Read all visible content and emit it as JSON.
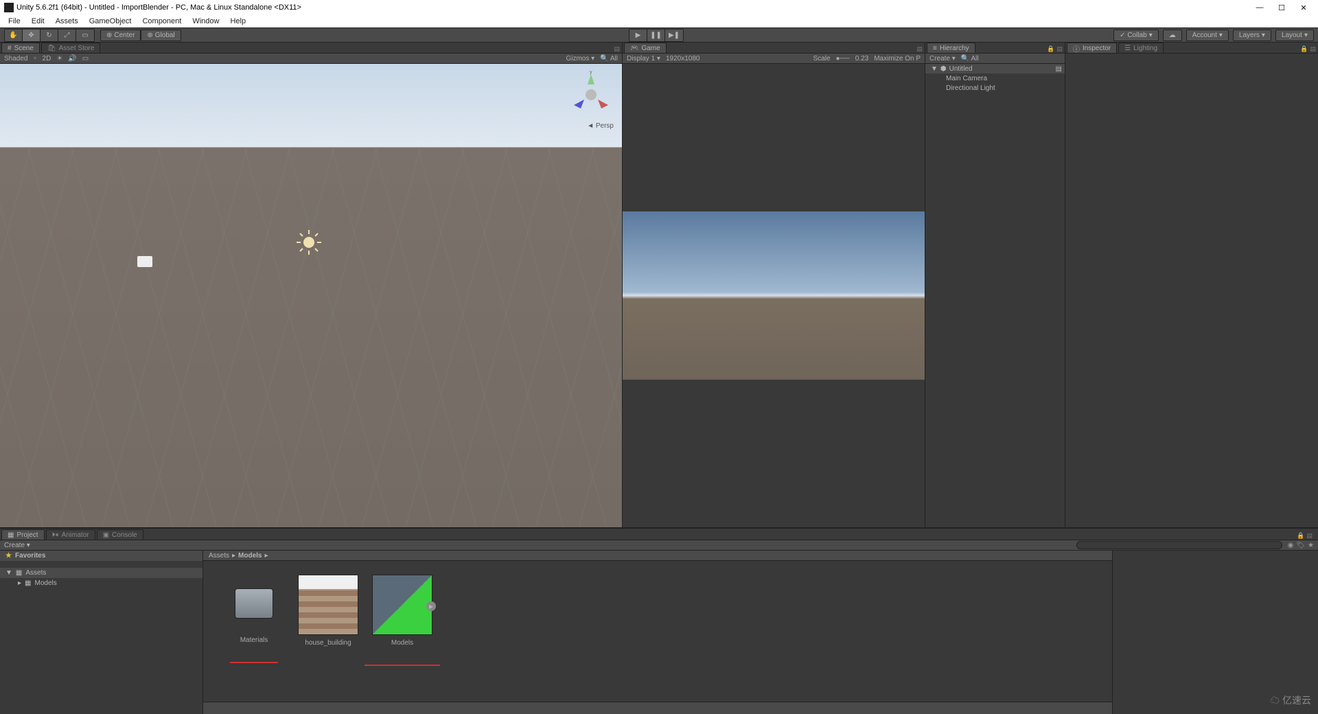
{
  "titlebar": {
    "title": "Unity 5.6.2f1 (64bit) - Untitled - ImportBlender - PC, Mac & Linux Standalone <DX11>"
  },
  "menubar": [
    "File",
    "Edit",
    "Assets",
    "GameObject",
    "Component",
    "Window",
    "Help"
  ],
  "toolbar": {
    "center": "Center",
    "global": "Global",
    "collab": "Collab",
    "account": "Account",
    "layers": "Layers",
    "layout": "Layout"
  },
  "scene": {
    "tab": "Scene",
    "tab2": "Asset Store",
    "shaded": "Shaded",
    "mode2d": "2D",
    "gizmos": "Gizmos",
    "search_placeholder": "All",
    "persp": "Persp"
  },
  "game": {
    "tab": "Game",
    "display": "Display 1",
    "resolution": "1920x1080",
    "scale": "Scale",
    "scale_val": "0.23",
    "maximize": "Maximize On P"
  },
  "hierarchy": {
    "tab": "Hierarchy",
    "create": "Create",
    "search_placeholder": "All",
    "scene_name": "Untitled",
    "items": [
      "Main Camera",
      "Directional Light"
    ]
  },
  "inspector": {
    "tab": "Inspector",
    "tab2": "Lighting"
  },
  "project": {
    "tab": "Project",
    "tab2": "Animator",
    "tab3": "Console",
    "create": "Create",
    "favorites": "Favorites",
    "assets": "Assets",
    "models": "Models",
    "breadcrumb": [
      "Assets",
      "Models"
    ],
    "items": [
      {
        "name": "Materials",
        "type": "folder",
        "underline": true
      },
      {
        "name": "house_building",
        "type": "texture",
        "underline": false
      },
      {
        "name": "Models",
        "type": "model",
        "underline": true
      }
    ]
  },
  "watermark": "亿速云"
}
